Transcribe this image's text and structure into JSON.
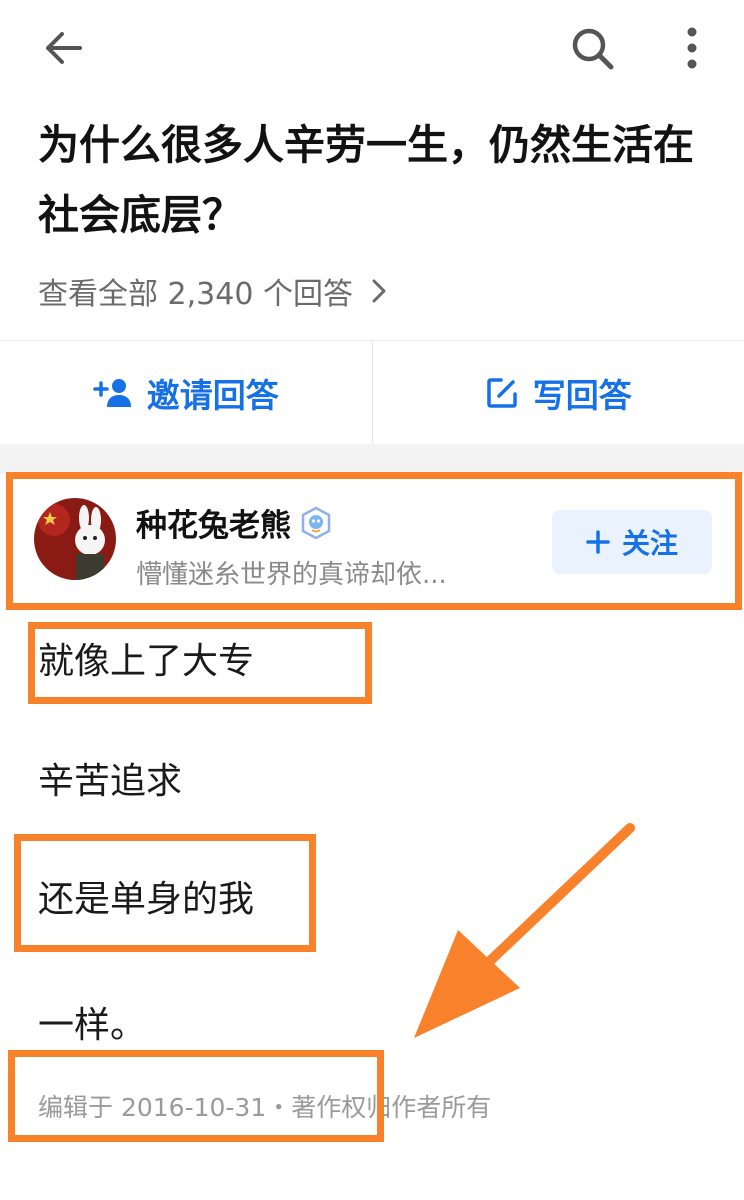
{
  "topbar": {
    "back_icon": "arrow-left-icon",
    "search_icon": "search-icon",
    "more_icon": "more-vertical-icon"
  },
  "question": {
    "title": "为什么很多人辛劳一生，仍然生活在社会底层？",
    "view_all": "查看全部 2,340 个回答"
  },
  "actions": {
    "invite_label": "邀请回答",
    "invite_icon": "add-user-icon",
    "write_label": "写回答",
    "write_icon": "edit-icon"
  },
  "author": {
    "name": "种花兔老熊",
    "bio": "懵懂迷糸世界的真谛却依...",
    "avatar_icon": "avatar-rabbit-icon",
    "badge_icon": "verified-badge-icon",
    "follow_label": "关注"
  },
  "answer": {
    "lines": [
      "就像上了大专",
      "辛苦追求",
      "还是单身的我",
      "一样。"
    ],
    "meta": "编辑于 2016-10-31・著作权归作者所有"
  },
  "colors": {
    "accent": "#1771e6",
    "highlight": "#f7822b",
    "follow_bg": "#eaf2fd"
  }
}
